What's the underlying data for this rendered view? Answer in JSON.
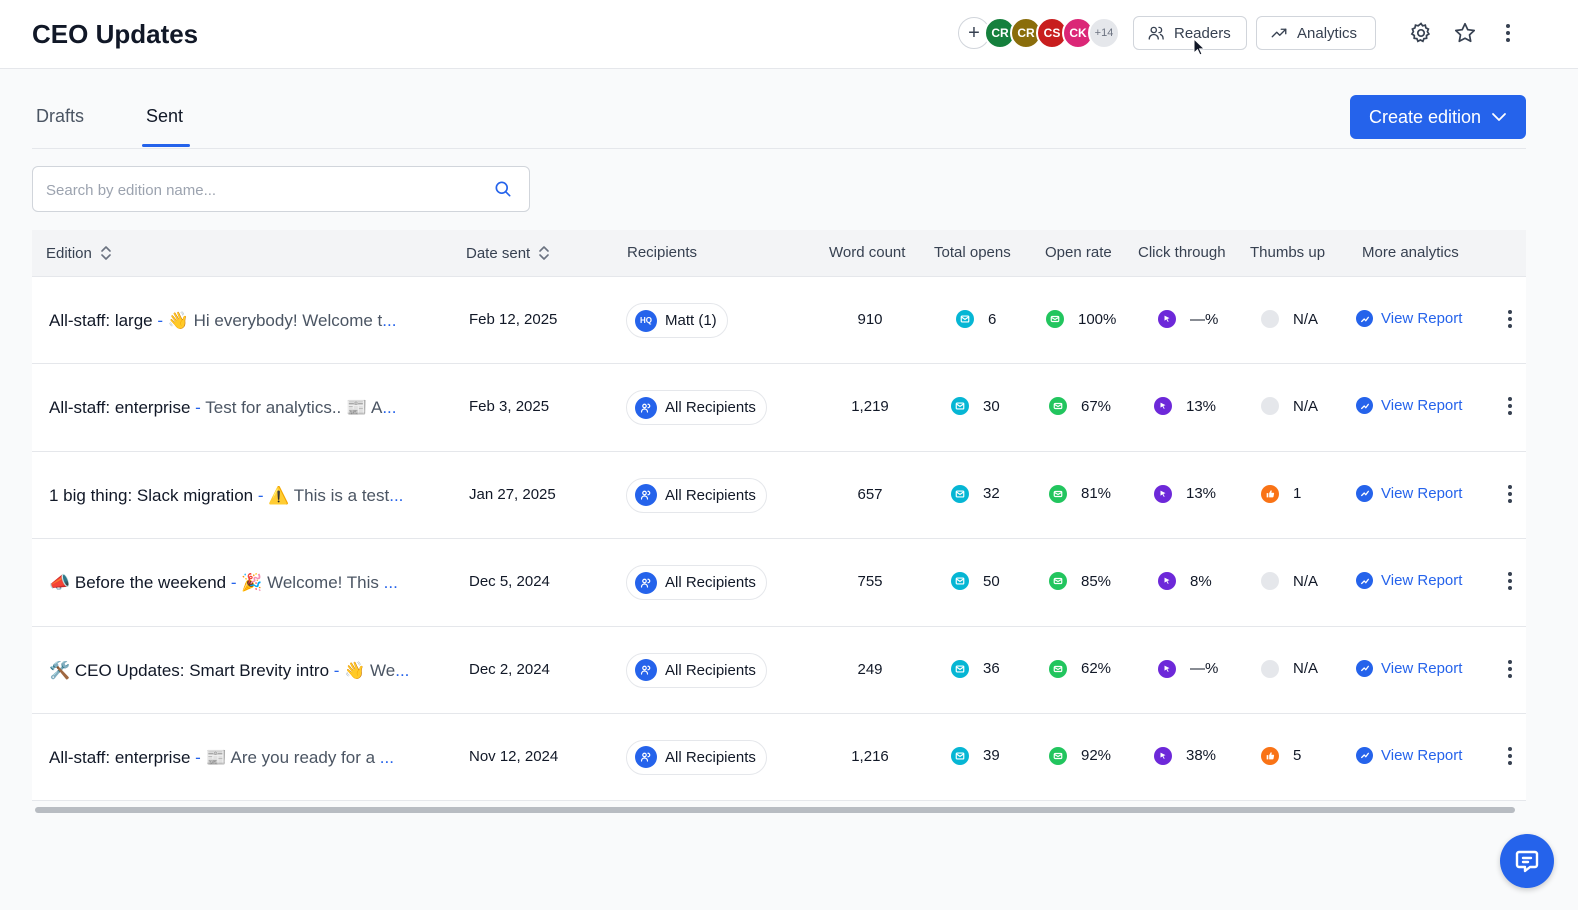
{
  "header": {
    "title": "CEO Updates",
    "avatars": [
      {
        "initials": "CR",
        "color": "#15803d"
      },
      {
        "initials": "CR",
        "color": "#8a6d0b"
      },
      {
        "initials": "CS",
        "color": "#c81e1e"
      },
      {
        "initials": "CK",
        "color": "#db2777"
      }
    ],
    "avatars_more": "+14",
    "readers_label": "Readers",
    "analytics_label": "Analytics"
  },
  "tabs": [
    {
      "label": "Drafts",
      "active": false
    },
    {
      "label": "Sent",
      "active": true
    }
  ],
  "create_button_label": "Create edition",
  "search": {
    "placeholder": "Search by edition name...",
    "value": ""
  },
  "table": {
    "columns": [
      "Edition",
      "Date sent",
      "Recipients",
      "Word count",
      "Total opens",
      "Open rate",
      "Click through",
      "Thumbs up",
      "More analytics"
    ],
    "report_label": "View Report",
    "rows": [
      {
        "title": "All-staff: large",
        "preview": "👋 Hi everybody! Welcome t",
        "date": "Feb 12, 2025",
        "recipients": "Matt (1)",
        "recipient_icon": "HQ",
        "word_count": "910",
        "opens": "6",
        "open_rate": "100%",
        "click": "—%",
        "thumbs": "N/A",
        "thumbs_active": false
      },
      {
        "title": "All-staff: enterprise",
        "preview": "Test for analytics.. 📰 A",
        "date": "Feb 3, 2025",
        "recipients": "All Recipients",
        "recipient_icon": "users",
        "word_count": "1,219",
        "opens": "30",
        "open_rate": "67%",
        "click": "13%",
        "thumbs": "N/A",
        "thumbs_active": false
      },
      {
        "title": "1 big thing: Slack migration",
        "preview": "⚠️ This is a test",
        "date": "Jan 27, 2025",
        "recipients": "All Recipients",
        "recipient_icon": "users",
        "word_count": "657",
        "opens": "32",
        "open_rate": "81%",
        "click": "13%",
        "thumbs": "1",
        "thumbs_active": true
      },
      {
        "title": "📣 Before the weekend",
        "preview": "🎉 Welcome! This ",
        "date": "Dec 5, 2024",
        "recipients": "All Recipients",
        "recipient_icon": "users",
        "word_count": "755",
        "opens": "50",
        "open_rate": "85%",
        "click": "8%",
        "thumbs": "N/A",
        "thumbs_active": false
      },
      {
        "title": "🛠️ CEO Updates: Smart Brevity intro",
        "preview": "👋 We",
        "date": "Dec 2, 2024",
        "recipients": "All Recipients",
        "recipient_icon": "users",
        "word_count": "249",
        "opens": "36",
        "open_rate": "62%",
        "click": "—%",
        "thumbs": "N/A",
        "thumbs_active": false
      },
      {
        "title": "All-staff: enterprise",
        "preview": "📰 Are you ready for a ",
        "date": "Nov 12, 2024",
        "recipients": "All Recipients",
        "recipient_icon": "users",
        "word_count": "1,216",
        "opens": "39",
        "open_rate": "92%",
        "click": "38%",
        "thumbs": "5",
        "thumbs_active": true
      }
    ]
  }
}
